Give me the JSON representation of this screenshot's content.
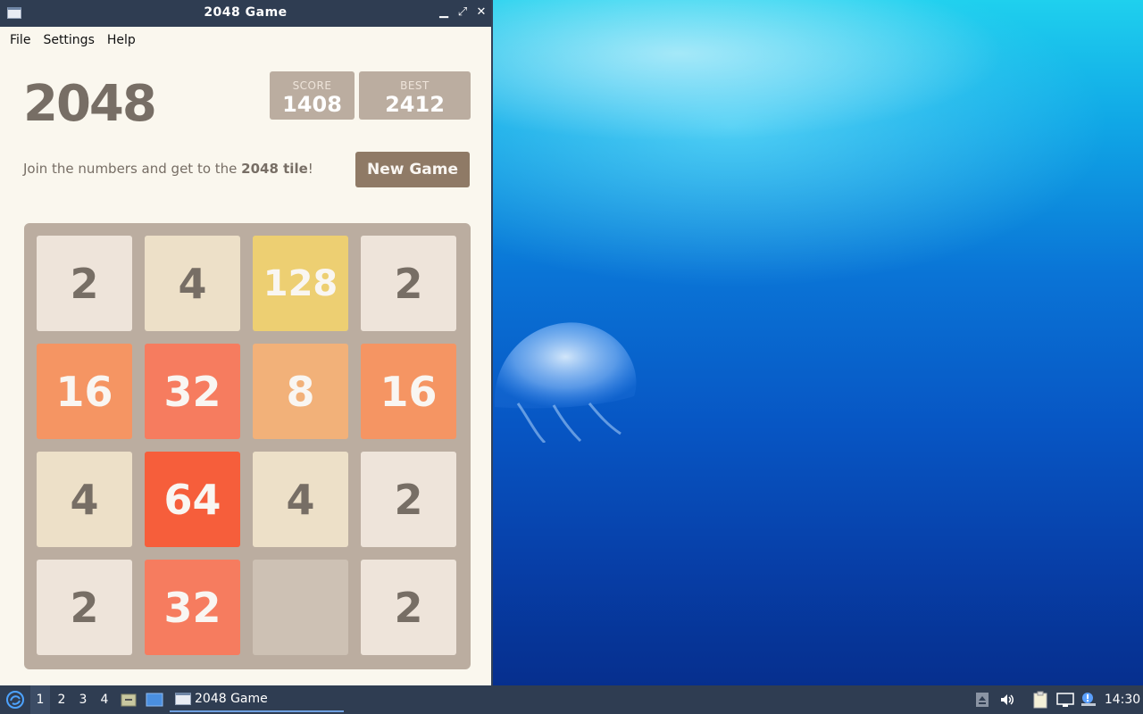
{
  "window": {
    "title": "2048 Game",
    "controls": {
      "minimize": "▁",
      "maximize": "⤢",
      "close": "✕"
    }
  },
  "menubar": {
    "items": [
      "File",
      "Settings",
      "Help"
    ]
  },
  "game": {
    "title": "2048",
    "score_label": "SCORE",
    "score_value": "1408",
    "best_label": "BEST",
    "best_value": "2412",
    "intro_prefix": "Join the numbers and get to the ",
    "intro_bold": "2048 tile",
    "intro_suffix": "!",
    "new_game_label": "New Game",
    "board": [
      [
        "2",
        "4",
        "128",
        "2"
      ],
      [
        "16",
        "32",
        "8",
        "16"
      ],
      [
        "4",
        "64",
        "4",
        "2"
      ],
      [
        "2",
        "32",
        "",
        "2"
      ]
    ],
    "tile_colors": {
      "": {
        "bg": "#cdc1b4",
        "fg": "#776e65"
      },
      "2": {
        "bg": "#eee4da",
        "fg": "#776e65"
      },
      "4": {
        "bg": "#ede0c8",
        "fg": "#776e65"
      },
      "8": {
        "bg": "#f2b179",
        "fg": "#f9f6f2"
      },
      "16": {
        "bg": "#f59563",
        "fg": "#f9f6f2"
      },
      "32": {
        "bg": "#f67c5f",
        "fg": "#f9f6f2"
      },
      "64": {
        "bg": "#f65e3b",
        "fg": "#f9f6f2"
      },
      "128": {
        "bg": "#edcf72",
        "fg": "#f9f6f2"
      }
    }
  },
  "taskbar": {
    "workspaces": [
      "1",
      "2",
      "3",
      "4"
    ],
    "active_workspace": "1",
    "task_label": "2048 Game",
    "clock": "14:30"
  },
  "colors": {
    "titlebar": "#2f3d52",
    "window_bg": "#faf7ee",
    "board_bg": "#bbada0",
    "button_bg": "#8f7a66"
  }
}
